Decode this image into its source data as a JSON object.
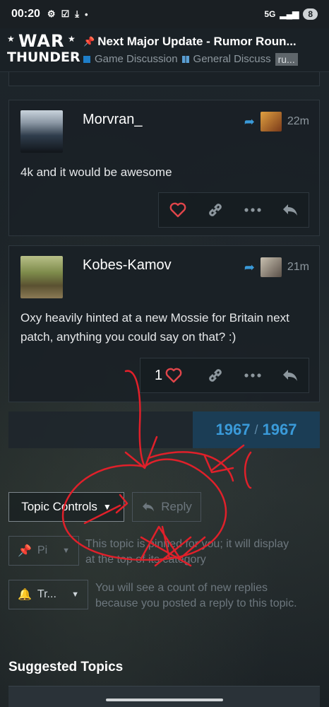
{
  "status_bar": {
    "time": "00:20",
    "network": "5G",
    "battery": "8"
  },
  "header": {
    "logo_line1": "WAR",
    "logo_line2": "THUNDER",
    "title": "Next Major Update - Rumor Roun...",
    "category1": "Game Discussion",
    "category2": "General Discuss",
    "tag": "ru..."
  },
  "posts": [
    {
      "username": "Morvran_",
      "time": "22m",
      "body": "4k and it would be awesome",
      "likes": ""
    },
    {
      "username": "Kobes-Kamov",
      "time": "21m",
      "body": "Oxy heavily hinted at a new Mossie for Britain next patch, anything you could say on that? :)",
      "likes": "1"
    }
  ],
  "pagination": {
    "current": "1967",
    "total": "1967"
  },
  "topic_controls": {
    "button_label": "Topic Controls",
    "reply_label": "Reply",
    "pinned_label": "Pi",
    "pinned_text": "This topic is pinned for you; it will display at the top of its category",
    "tracking_label": "Tr...",
    "tracking_text": "You will see a count of new replies because you posted a reply to this topic."
  },
  "suggested_heading": "Suggested Topics",
  "colors": {
    "accent": "#3a9ad9",
    "heart": "#e0454a",
    "scribble": "#e0202a"
  }
}
